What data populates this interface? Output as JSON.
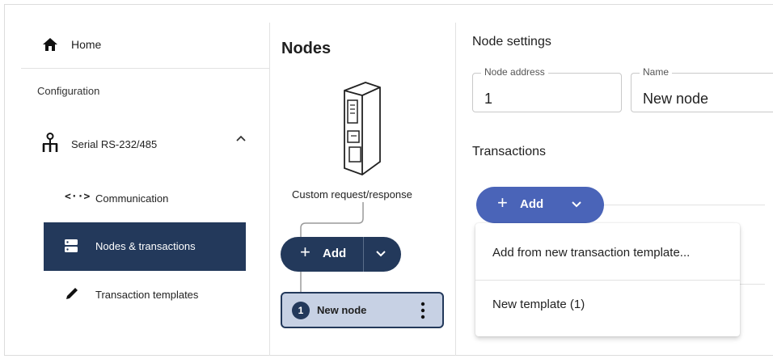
{
  "sidebar": {
    "home_label": "Home",
    "section_label": "Configuration",
    "serial_label": "Serial RS-232/485",
    "items": [
      {
        "label": "Communication",
        "icon": "code-arrows-icon",
        "glyph": "<··>"
      },
      {
        "label": "Nodes & transactions",
        "icon": "server-icon",
        "selected": true
      },
      {
        "label": "Transaction templates",
        "icon": "pencil-icon"
      }
    ]
  },
  "nodes": {
    "title": "Nodes",
    "device_label": "Custom request/response",
    "add_label": "Add",
    "node": {
      "number": "1",
      "name": "New node"
    }
  },
  "settings": {
    "title": "Node settings",
    "address_label": "Node address",
    "address_value": "1",
    "name_label": "Name",
    "name_value": "New node",
    "transactions_title": "Transactions",
    "add_label": "Add"
  },
  "menu": {
    "items": [
      "Add from new transaction template...",
      "New template (1)"
    ]
  },
  "colors": {
    "primary_dark": "#23395b",
    "primary_blue": "#4a64b8",
    "selected_card": "#c7d1e4"
  }
}
